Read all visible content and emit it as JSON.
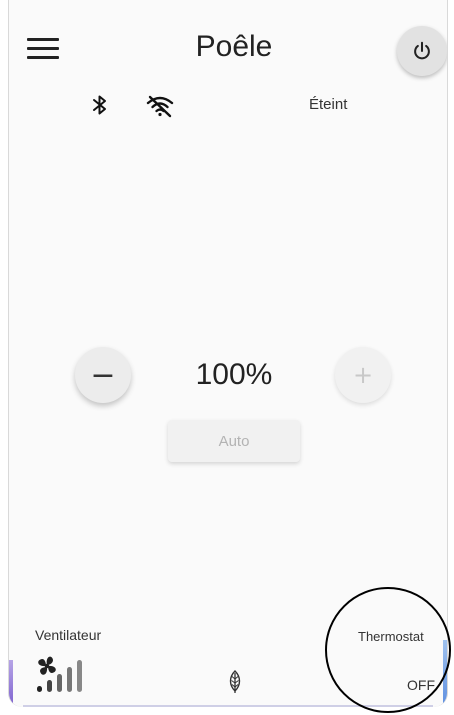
{
  "header": {
    "title": "Poêle",
    "menu_icon": "menu-icon",
    "power_icon": "power-icon"
  },
  "status": {
    "bluetooth_icon": "bluetooth-icon",
    "wifi_icon": "wifi-off-icon",
    "state": "Éteint"
  },
  "control": {
    "minus_label": "−",
    "plus_label": "+",
    "level": "100%",
    "auto_label": "Auto"
  },
  "bottom": {
    "fan_label": "Ventilateur",
    "fan_icon": "fan-speed-icon",
    "eco_icon": "leaf-icon",
    "thermostat_label": "Thermostat",
    "thermostat_value": "OFF"
  },
  "colors": {
    "background": "#fafafa",
    "text": "#222222",
    "button": "#e2e2e2",
    "disabled_text": "#b3b3b3"
  }
}
